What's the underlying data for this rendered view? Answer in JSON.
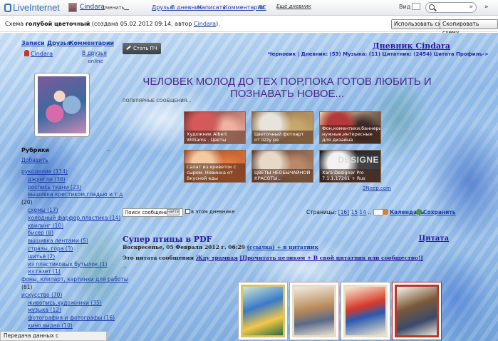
{
  "topbar": {
    "logo": "LiveInternet",
    "user_name": "Cindara",
    "change_label": "сменить",
    "nav": [
      "Друзья",
      "В дневник",
      "Написать",
      "Комментарии",
      "ЛС"
    ],
    "settings_label": "Ещё дневник",
    "view_label": "Вид",
    "search_value": "",
    "search_go": "»",
    "more": "»"
  },
  "schemebar": {
    "prefix": "Схема ",
    "scheme_name": "голубой цветочный",
    "created": " (создана 05.02.2012 09:14, автор ",
    "author": "Cindara",
    "suffix": ").",
    "use_button": "Использовать схему",
    "copy_button": "Скопировать схему"
  },
  "sidebar": {
    "nav": [
      "Записи",
      "Друзья",
      "Комментарии"
    ],
    "user_name": "Cindara",
    "friends_add": "В друзья",
    "online": "online",
    "rubriki_title": "Рубрики",
    "rubriki_dash": "-",
    "add_label": "Добавить",
    "rubrics": [
      {
        "text": "рукоделие (114)",
        "indent": 0,
        "link": true
      },
      {
        "text": "джунгли (36)",
        "indent": 1,
        "link": true
      },
      {
        "text": "роспись ткани (23)",
        "indent": 1,
        "link": true
      },
      {
        "text": "вышивка крестиком,гладью и т.д",
        "indent": 1,
        "link": true
      },
      {
        "text": "(20)",
        "indent": 0,
        "link": false
      },
      {
        "text": "схемы (17)",
        "indent": 1,
        "link": true
      },
      {
        "text": "холодный фарфор,пластика (14)",
        "indent": 1,
        "link": true
      },
      {
        "text": "квилинг (10)",
        "indent": 1,
        "link": true
      },
      {
        "text": "бисер (8)",
        "indent": 1,
        "link": true
      },
      {
        "text": "вышивка лентами (5)",
        "indent": 1,
        "link": true
      },
      {
        "text": "стразы, гора (3)",
        "indent": 1,
        "link": true
      },
      {
        "text": "шитьё (2)",
        "indent": 1,
        "link": true
      },
      {
        "text": "из пластиковых бутылок (1)",
        "indent": 1,
        "link": true
      },
      {
        "text": "из газет (1)",
        "indent": 1,
        "link": true
      },
      {
        "text": "фоны, клипарт, картинки для работы",
        "indent": 0,
        "link": true
      },
      {
        "text": "(81)",
        "indent": 0,
        "link": false
      },
      {
        "text": "искусство (70)",
        "indent": 0,
        "link": true
      },
      {
        "text": "живопись,художники (35)",
        "indent": 1,
        "link": true
      },
      {
        "text": "музыка (12)",
        "indent": 1,
        "link": true
      },
      {
        "text": "фотография и фотографы (16)",
        "indent": 1,
        "link": true
      },
      {
        "text": "кино,видео (10)",
        "indent": 1,
        "link": true
      },
      {
        "text": "мастер - классы (63)",
        "indent": 0,
        "link": true
      }
    ]
  },
  "main": {
    "post_button": "Стать ПЧ",
    "diary_title": "Дневник Cindara",
    "diary_meta": "Черновик | Дневник: (53) Музыка: (11) Цитатник: (2454) Цитата Профиль->",
    "motto": "ЧЕЛОВЕК МОЛОД ДО ТЕХ ПОР,ПОКА ГОТОВ ЛЮБИТЬ И ПОЗНАВАТЬ НОВОЕ...",
    "popular_label": "ПОПУЛЯРНЫЕ СООБЩЕНИЯ...",
    "tiles": [
      {
        "caption": "Художник Albert Williams . Цветы",
        "colors": [
          "#d45a5a",
          "#f0b2a0",
          "#7a2a2a"
        ]
      },
      {
        "caption": "Цветочный фотоарт от lizzy ре",
        "colors": [
          "#e8e4dc",
          "#c9a66b",
          "#8a6a4a"
        ]
      },
      {
        "caption": "Фон,коментики,баннеры нужные,интересные для дизайна",
        "colors": [
          "#b23a3a",
          "#3a2a2a",
          "#f0d0a0"
        ]
      },
      {
        "caption": "Салат из креветок с сыром. Новинка от Вкусной еды",
        "colors": [
          "#f2c9a0",
          "#e07a40",
          "#a04a20"
        ]
      },
      {
        "caption": "ЦВЕТЫ НЕОБЫЧАЙНОЙ КРАСОТЫ...",
        "colors": [
          "#e8d8c8",
          "#b88a6a",
          "#5a3a2a"
        ]
      },
      {
        "caption": "Xara Designer Pro 7.1.1.17261 + Rus",
        "colors": [
          "#f2f2f2",
          "#444444",
          "#111111"
        ],
        "dark_word": "DESIGNE"
      }
    ],
    "liveep": "2Neep.com",
    "strip": {
      "search_value": "Поиск сообщений",
      "search_btn": "найти",
      "in_diary": "в этом дневнике",
      "pages_label": "Страницы: ",
      "pages": [
        "[16]",
        "15",
        "14"
      ],
      "pages_more": "..",
      "calendar": "Календарь",
      "save": "Сохранить"
    },
    "post": {
      "title": "Супер птицы в PDF",
      "quote_link": "Цитата",
      "date": "Воскресенье, 05 Февраля 2012 г. 06:29 ",
      "date_link": "(ссылка)",
      "date_tail": " + в цитатник",
      "quote_prefix": "Это цитата сообщения ",
      "quote_user": "Жду трамвая",
      "quote_action": "[Прочитать целиком + В свой цитатник или сообщество!]",
      "quote_mark": "“"
    }
  },
  "statusbar": {
    "text": "Передача данных с www.liveinternet.ru..."
  }
}
